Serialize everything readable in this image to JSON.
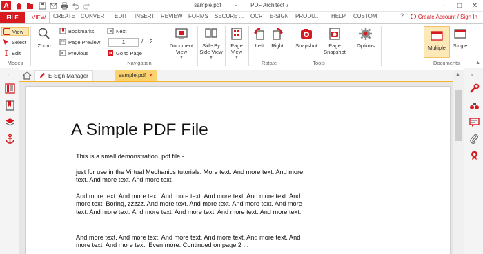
{
  "window": {
    "file_name": "sample.pdf",
    "separator": "-",
    "app_name": "PDF Architect 7",
    "app_logo": "A"
  },
  "ribbon_tabs": {
    "file": "FILE",
    "items": [
      "VIEW",
      "CREATE",
      "CONVERT",
      "EDIT",
      "INSERT",
      "REVIEW",
      "FORMS",
      "SECURE ...",
      "OCR",
      "E-SIGN",
      "PRODU...",
      "HELP",
      "CUSTOM"
    ],
    "active": "VIEW",
    "account_link": "Create Account / Sign In",
    "help_glyph": "?"
  },
  "ribbon": {
    "modes": {
      "label": "Modes",
      "view": "View",
      "select": "Select",
      "edit": "Edit"
    },
    "navigation": {
      "label": "Navigation",
      "zoom": "Zoom",
      "bookmarks": "Bookmarks",
      "page_preview": "Page Preview",
      "previous": "Previous",
      "next": "Next",
      "page_current": "1",
      "page_sep": "/",
      "page_total": "2",
      "go_to_page": "Go to Page",
      "document_view": "Document View",
      "side_by_side": "Side By Side View",
      "page_view": "Page View"
    },
    "rotate": {
      "label": "Rotate",
      "left": "Left",
      "right": "Right"
    },
    "tools": {
      "label": "Tools",
      "snapshot": "Snapshot",
      "page_snapshot": "Page Snapshot",
      "options": "Options"
    },
    "documents": {
      "label": "Documents",
      "multiple": "Multiple",
      "single": "Single"
    }
  },
  "doc_tabs": {
    "esign": "E-Sign Manager",
    "sample": "sample.pdf",
    "close": "×"
  },
  "document": {
    "title": "A Simple PDF File",
    "paragraphs": [
      "This is a small demonstration .pdf file -",
      "just for use in the Virtual Mechanics tutorials. More text. And more text. And more text. And more text. And more text.",
      "And more text. And more text. And more text. And more text. And more text. And more text. Boring, zzzzz. And more text. And more text. And more text. And more text. And more text. And more text. And more text. And more text. And more text.",
      "And more text. And more text. And more text. And more text. And more text. And more text. And more text. Even more. Continued on page 2 ..."
    ]
  },
  "colors": {
    "brand": "#d71920",
    "active_highlight": "#fde8b8",
    "tab_underline": "#f4b32a"
  }
}
